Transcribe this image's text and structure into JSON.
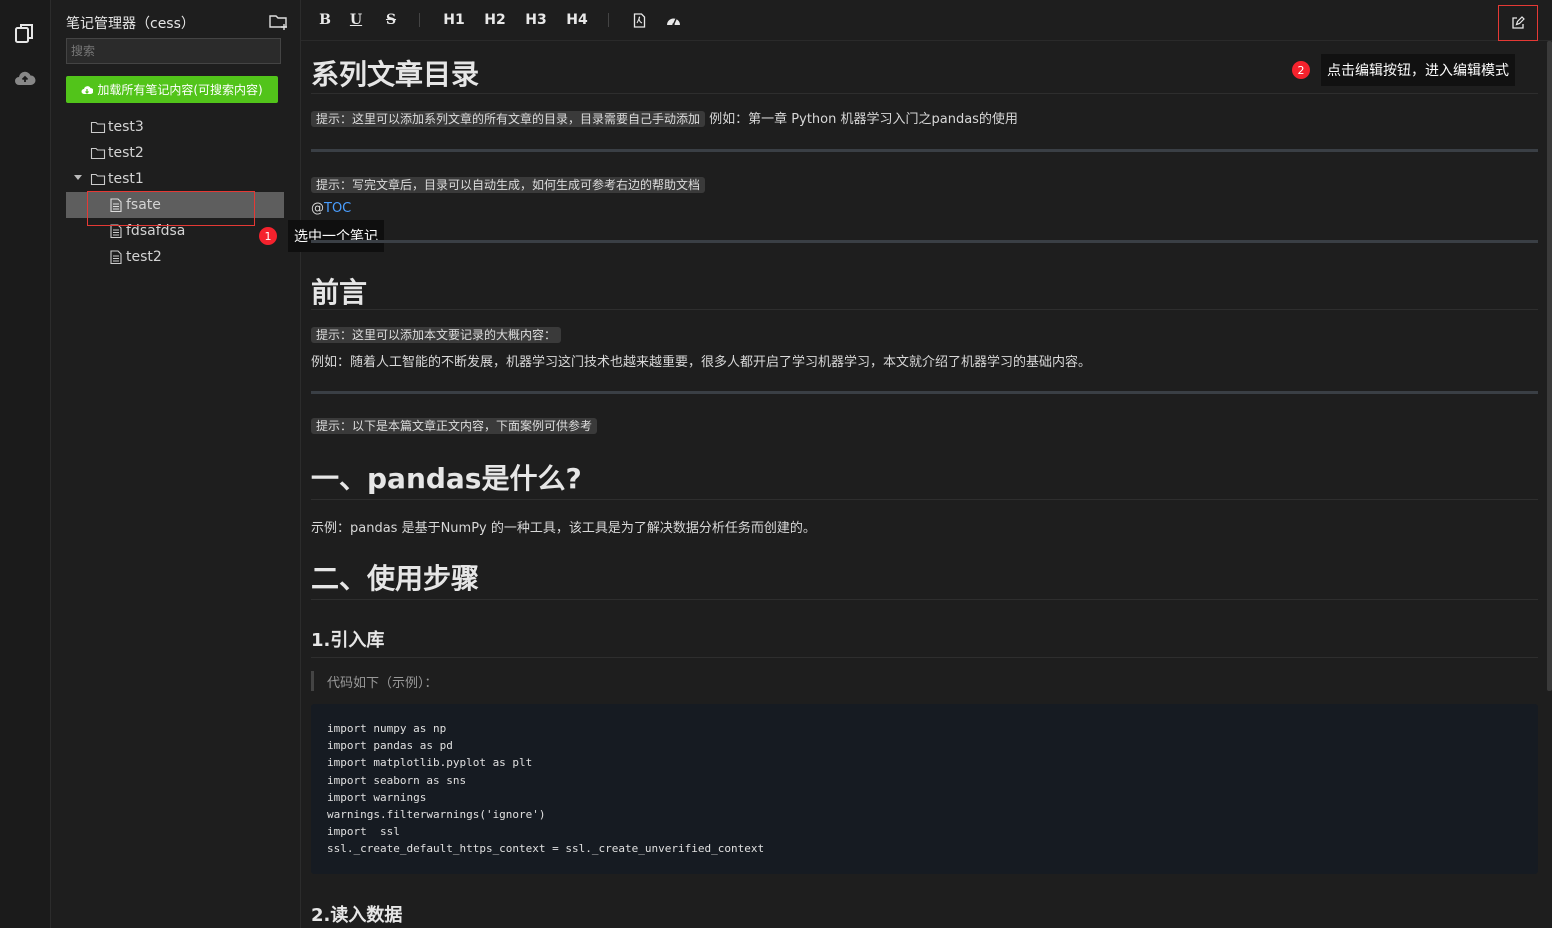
{
  "sidebar": {
    "title": "笔记管理器（cess）",
    "search_placeholder": "搜索",
    "load_button": "加载所有笔记内容(可搜索内容)",
    "tree": [
      {
        "type": "folder",
        "label": "test3"
      },
      {
        "type": "folder",
        "label": "test2"
      },
      {
        "type": "folder",
        "label": "test1",
        "expanded": true
      },
      {
        "type": "file",
        "label": "fsate",
        "selected": true
      },
      {
        "type": "file",
        "label": "fdsafdsa"
      },
      {
        "type": "file",
        "label": "test2"
      }
    ]
  },
  "callouts": {
    "one": {
      "num": "1",
      "text": "选中一个笔记"
    },
    "two": {
      "num": "2",
      "text": "点击编辑按钮，进入编辑模式"
    }
  },
  "toolbar": {
    "bold": "B",
    "underline": "U",
    "strike": "S",
    "h1": "H1",
    "h2": "H2",
    "h3": "H3",
    "h4": "H4"
  },
  "doc": {
    "title": "系列文章目录",
    "tip1": "提示：这里可以添加系列文章的所有文章的目录，目录需要自己手动添加",
    "tip1_example": "例如：第一章 Python 机器学习入门之pandas的使用",
    "tip2": "提示：写完文章后，目录可以自动生成，如何生成可参考右边的帮助文档",
    "toc_at": "@",
    "toc_link": "TOC",
    "preface": "前言",
    "tip3": "提示：这里可以添加本文要记录的大概内容：",
    "preface_text": "例如：随着人工智能的不断发展，机器学习这门技术也越来越重要，很多人都开启了学习机器学习，本文就介绍了机器学习的基础内容。",
    "tip4": "提示：以下是本篇文章正文内容，下面案例可供参考",
    "h_pandas": "一、pandas是什么?",
    "pandas_text": "示例：pandas 是基于NumPy 的一种工具，该工具是为了解决数据分析任务而创建的。",
    "h_steps": "二、使用步骤",
    "h_import": "1.引入库",
    "quote": "代码如下（示例）：",
    "code": [
      "import numpy as np",
      "import pandas as pd",
      "import matplotlib.pyplot as plt",
      "import seaborn as sns",
      "import warnings",
      "warnings.filterwarnings('ignore')",
      "import  ssl",
      "ssl._create_default_https_context = ssl._create_unverified_context"
    ],
    "h_read": "2.读入数据"
  },
  "colors": {
    "accent_green": "#52c41a",
    "callout_red": "#f5222d",
    "link": "#4a9eff"
  }
}
